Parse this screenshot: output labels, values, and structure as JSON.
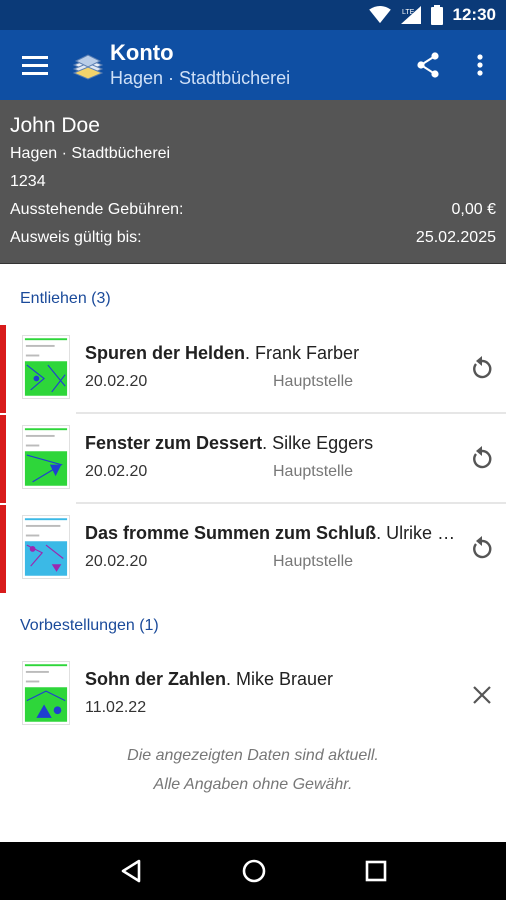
{
  "status_bar": {
    "time": "12:30",
    "network_label": "LTE"
  },
  "app_bar": {
    "title": "Konto",
    "subtitle": "Hagen · Stadtbücherei"
  },
  "account": {
    "name": "John Doe",
    "library": "Hagen · Stadtbücherei",
    "card_number": "1234",
    "fees_label": "Ausstehende Gebühren:",
    "fees_value": "0,00 €",
    "valid_label": "Ausweis gültig bis:",
    "valid_value": "25.02.2025"
  },
  "lent": {
    "header": "Entliehen (3)",
    "items": [
      {
        "title": "Spuren der Helden",
        "author": ". Frank Farber",
        "date": "20.02.20",
        "branch": "Hauptstelle",
        "cover_color": "#2ed63a"
      },
      {
        "title": "Fenster zum Dessert",
        "author": ". Silke Eggers",
        "date": "20.02.20",
        "branch": "Hauptstelle",
        "cover_color": "#2ed63a"
      },
      {
        "title": "Das fromme Summen zum Schluß",
        "author": ". Ulrike Müller",
        "date": "20.02.20",
        "branch": "Hauptstelle",
        "cover_color": "#3bb9e6"
      }
    ]
  },
  "reservations": {
    "header": "Vorbestellungen (1)",
    "items": [
      {
        "title": "Sohn der Zahlen",
        "author": ". Mike Brauer",
        "date": "11.02.22",
        "cover_color": "#2ed63a"
      }
    ]
  },
  "footer": {
    "line1": "Die angezeigten Daten sind aktuell.",
    "line2": "Alle Angaben ohne Gewähr."
  },
  "colors": {
    "primary": "#0f4fa3",
    "status_bar": "#0b3a78",
    "header_bg": "#555555",
    "accent_red": "#d81b1b",
    "section_blue": "#1a4a9a"
  }
}
